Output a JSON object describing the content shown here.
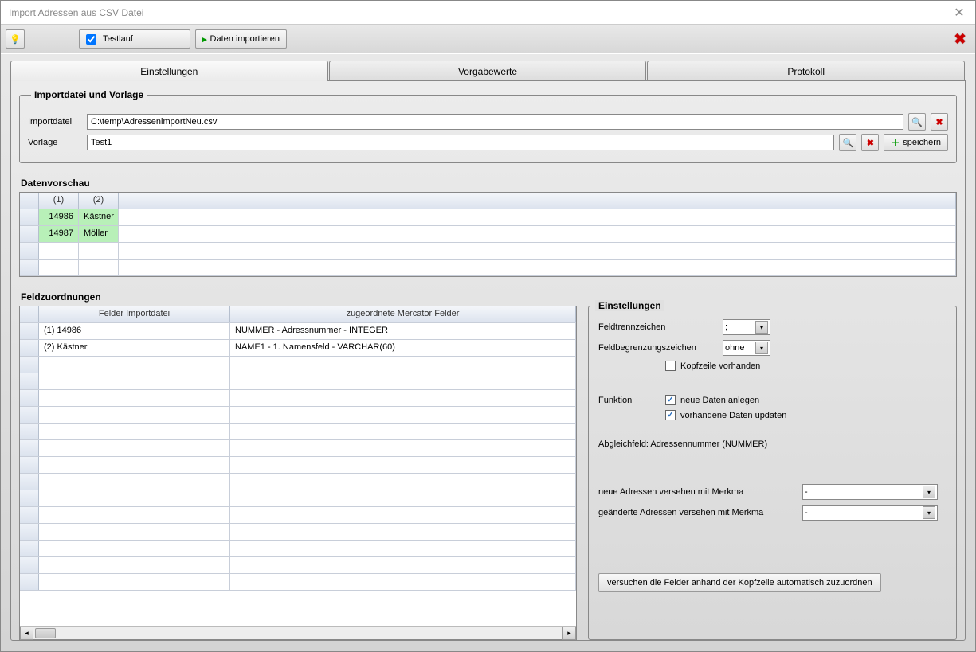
{
  "window": {
    "title": "Import Adressen aus CSV Datei"
  },
  "toolbar": {
    "hint_icon": "lightbulb",
    "testlauf_label": "Testlauf",
    "testlauf_checked": true,
    "import_label": "Daten importieren",
    "close_icon": "close-red"
  },
  "tabs": {
    "t1": "Einstellungen",
    "t2": "Vorgabewerte",
    "t3": "Protokoll",
    "active": "t1"
  },
  "importbox": {
    "title": "Importdatei und Vorlage",
    "file_label": "Importdatei",
    "file_value": "C:\\temp\\AdressenimportNeu.csv",
    "template_label": "Vorlage",
    "template_value": "Test1",
    "save_label": "speichern"
  },
  "preview": {
    "title": "Datenvorschau",
    "headers": [
      "(1)",
      "(2)"
    ],
    "rows": [
      [
        "14986",
        "Kästner"
      ],
      [
        "14987",
        "Möller"
      ]
    ],
    "empty_rows": 2
  },
  "fieldmap": {
    "title": "Feldzuordnungen",
    "col1": "Felder Importdatei",
    "col2": "zugeordnete Mercator Felder",
    "rows": [
      {
        "left": "(1) 14986",
        "right": "NUMMER - Adressnummer - INTEGER"
      },
      {
        "left": "(2) Kästner",
        "right": "NAME1 - 1. Namensfeld - VARCHAR(60)"
      }
    ],
    "empty_rows": 14
  },
  "settings": {
    "title": "Einstellungen",
    "sep_label": "Feldtrennzeichen",
    "sep_value": ";",
    "delim_label": "Feldbegrenzungszeichen",
    "delim_value": "ohne",
    "header_label": "Kopfzeile vorhanden",
    "header_checked": false,
    "func_label": "Funktion",
    "func_new_label": "neue Daten anlegen",
    "func_new_checked": true,
    "func_update_label": "vorhandene Daten updaten",
    "func_update_checked": true,
    "matchfield": "Abgleichfeld: Adressennummer (NUMMER)",
    "new_merkmal_label": "neue Adressen versehen mit Merkma",
    "new_merkmal_value": "-",
    "changed_merkmal_label": "geänderte Adressen versehen mit Merkma",
    "changed_merkmal_value": "-",
    "auto_assign_btn": "versuchen die Felder anhand der Kopfzeile automatisch zuzuordnen"
  }
}
